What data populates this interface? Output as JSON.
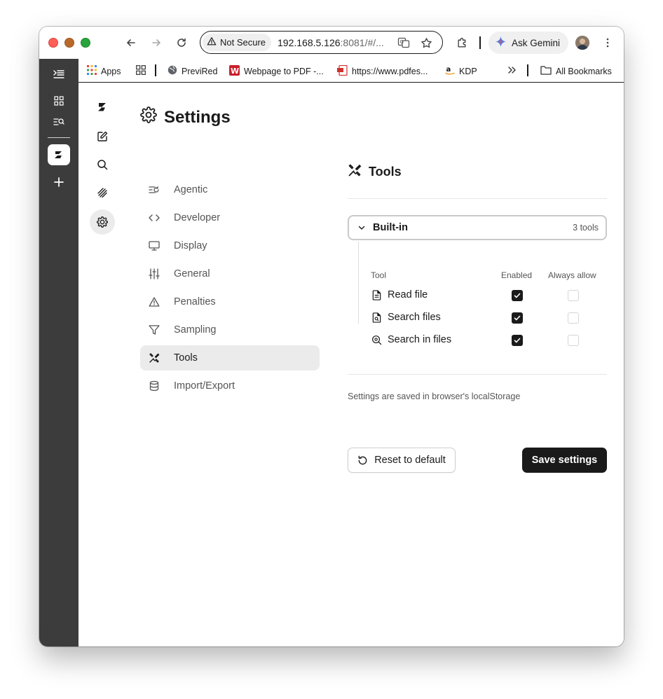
{
  "browser": {
    "security_label": "Not Secure",
    "url_main": "192.168.5.126",
    "url_rest": ":8081/#/...",
    "gemini_label": "Ask Gemini"
  },
  "bookmarks": [
    {
      "label": "Apps",
      "icon": "apps-grid-icon"
    },
    {
      "label": "PreviRed",
      "icon": "globe-icon"
    },
    {
      "label": "Webpage to PDF -...",
      "icon": "w-logo-icon"
    },
    {
      "label": "https://www.pdfes...",
      "icon": "pdf-icon"
    },
    {
      "label": "KDP",
      "icon": "amazon-icon"
    }
  ],
  "all_bookmarks_label": "All Bookmarks",
  "settings": {
    "title": "Settings",
    "nav": [
      {
        "label": "Agentic",
        "icon": "agentic-icon"
      },
      {
        "label": "Developer",
        "icon": "code-icon"
      },
      {
        "label": "Display",
        "icon": "monitor-icon"
      },
      {
        "label": "General",
        "icon": "sliders-icon"
      },
      {
        "label": "Penalties",
        "icon": "warning-icon"
      },
      {
        "label": "Sampling",
        "icon": "filter-icon"
      },
      {
        "label": "Tools",
        "icon": "tools-icon",
        "active": true
      },
      {
        "label": "Import/Export",
        "icon": "database-icon"
      }
    ]
  },
  "tools_panel": {
    "title": "Tools",
    "group_name": "Built-in",
    "group_count": "3 tools",
    "columns": {
      "tool": "Tool",
      "enabled": "Enabled",
      "always_allow": "Always allow"
    },
    "rows": [
      {
        "name": "Read file",
        "icon": "file-text-icon",
        "enabled": true,
        "always_allow": false
      },
      {
        "name": "Search files",
        "icon": "file-search-icon",
        "enabled": true,
        "always_allow": false
      },
      {
        "name": "Search in files",
        "icon": "zoom-in-icon",
        "enabled": true,
        "always_allow": false
      }
    ],
    "note": "Settings are saved in browser's localStorage",
    "reset_label": "Reset to default",
    "save_label": "Save settings"
  },
  "colors": {
    "primary_button": "#1a1a1a",
    "active_nav": "#ebebeb",
    "rail": "#3c3c3c"
  }
}
